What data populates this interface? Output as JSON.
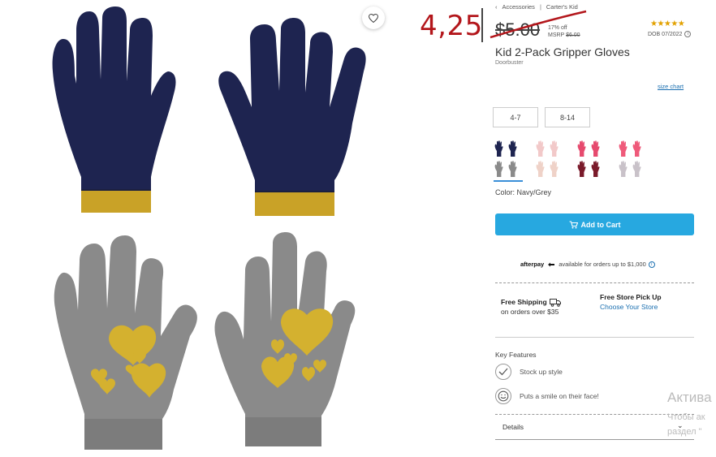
{
  "breadcrumb": [
    "Accessories",
    "Carter's Kid"
  ],
  "handwritten_price": "4,25",
  "price": {
    "current": "$5.00",
    "discount": "17% off",
    "msrp_label": "MSRP",
    "msrp_value": "$6.00"
  },
  "rating": {
    "stars": "★★★★★",
    "dob": "DOB 07/2022"
  },
  "product": {
    "title": "Kid 2-Pack Gripper Gloves",
    "badge": "Doorbuster"
  },
  "size_chart_label": "size chart",
  "sizes": [
    "4-7",
    "8-14"
  ],
  "swatches": [
    {
      "name": "Navy/Grey",
      "top": "#1e2450",
      "bottom": "#8a8a8a",
      "selected": true
    },
    {
      "name": "Pink/Multi",
      "top": "#f2c9c9",
      "bottom": "#efd2c8",
      "selected": false
    },
    {
      "name": "Pink/Burgundy",
      "top": "#e64a6e",
      "bottom": "#7a1a2a",
      "selected": false
    },
    {
      "name": "Pink/Grey",
      "top": "#ef5a7a",
      "bottom": "#c9c2c9",
      "selected": false
    }
  ],
  "color_label": "Color: Navy/Grey",
  "add_to_cart": "Add to Cart",
  "afterpay": {
    "brand": "afterpay",
    "text": "available for orders up to $1,000"
  },
  "shipping": {
    "title": "Free Shipping",
    "sub": "on orders over $35"
  },
  "pickup": {
    "title": "Free Store Pick Up",
    "link": "Choose Your Store"
  },
  "key_features": {
    "title": "Key Features",
    "items": [
      {
        "icon": "check-icon",
        "label": "Stock up style"
      },
      {
        "icon": "smile-icon",
        "label": "Puts a smile on their face!"
      }
    ]
  },
  "details_label": "Details",
  "os_watermark": {
    "line1": "Актива",
    "line2": "Чтобы ак",
    "line3": "раздел \""
  },
  "colors": {
    "accent": "#27a8e0",
    "navy": "#1e2450",
    "mustard": "#c9a227",
    "grey": "#8a8a8a",
    "gold": "#d4b12f",
    "hand_red": "#b3161b"
  }
}
